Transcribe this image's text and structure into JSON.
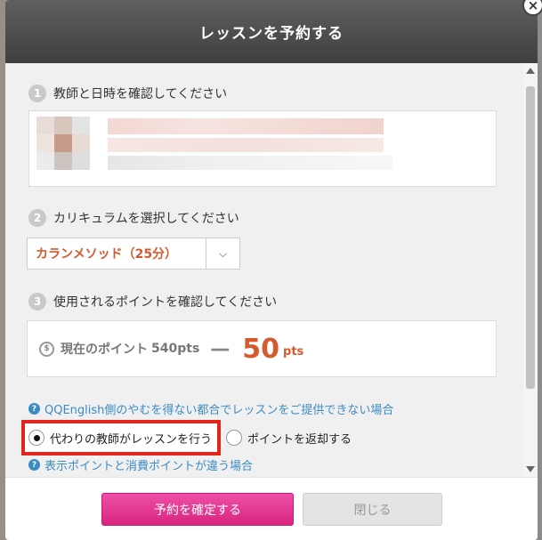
{
  "modal": {
    "title": "レッスンを予約する",
    "close_icon": "×"
  },
  "steps": [
    {
      "num": "1",
      "label": "教師と日時を確認してください"
    },
    {
      "num": "2",
      "label": "カリキュラムを選択してください"
    },
    {
      "num": "3",
      "label": "使用されるポイントを確認してください"
    }
  ],
  "curriculum": {
    "selected": "カランメソッド（25分）",
    "caret": "⌵"
  },
  "points": {
    "coin_icon": "$",
    "label": "現在のポイント",
    "current": "540pts",
    "minus": "—",
    "use_value": "50",
    "use_unit": "pts"
  },
  "help_links": {
    "unavailable": "QQEnglish側のやむを得ない都合でレッスンをご提供できない場合",
    "points_diff": "表示ポイントと消費ポイントが違う場合",
    "icon": "?"
  },
  "radios": {
    "replace_teacher": "代わりの教師がレッスンを行う",
    "refund_points": "ポイントを返却する",
    "selected": "replace_teacher"
  },
  "footer": {
    "confirm_label": "予約を確定する",
    "close_label": "閉じる"
  },
  "colors": {
    "accent_orange": "#d55a2e",
    "link_blue": "#3b8bc4",
    "confirm_pink": "#e43a93",
    "highlight_red": "#e0261f"
  }
}
